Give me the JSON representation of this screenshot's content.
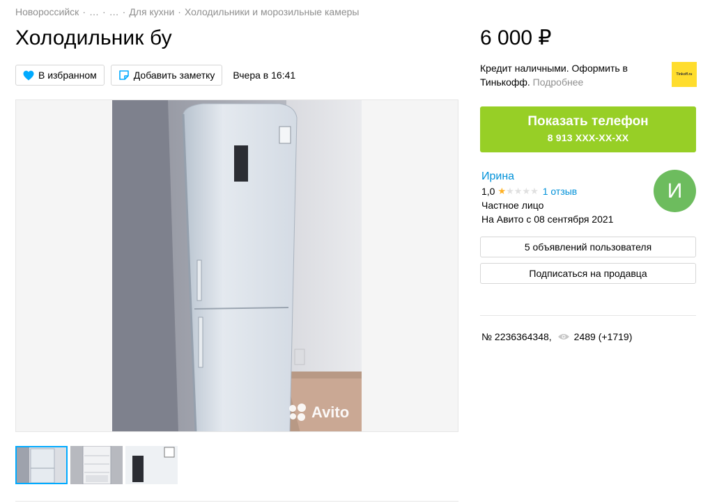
{
  "breadcrumbs": {
    "city": "Новороссийск",
    "sep": "·",
    "ellipsis1": "…",
    "ellipsis2": "…",
    "category": "Для кухни",
    "subcategory": "Холодильники и морозильные камеры"
  },
  "listing": {
    "title": "Холодильник бу",
    "favorite_label": "В избранном",
    "note_label": "Добавить заметку",
    "date": "Вчера в 16:41",
    "price": "6 000 ₽"
  },
  "gallery": {
    "watermark": "Avito",
    "active_thumb": 1,
    "thumb_count": 3
  },
  "credit": {
    "text": "Кредит наличными. Оформить в Тинькофф.",
    "more": "Подробнее",
    "logo_text": "Tinkoff.ru"
  },
  "call": {
    "label": "Показать телефон",
    "phone": "8 913 XXX-XX-XX"
  },
  "seller": {
    "name": "Ирина",
    "rating": "1,0",
    "stars_filled": 1,
    "stars_total": 5,
    "reviews": "1 отзыв",
    "type": "Частное лицо",
    "since": "На Авито с 08 сентября 2021",
    "avatar_letter": "И"
  },
  "buttons": {
    "user_ads": "5 объявлений пользователя",
    "subscribe": "Подписаться на продавца"
  },
  "meta": {
    "number": "№ 2236364348,",
    "views": "2489 (+1719)"
  },
  "colors": {
    "accent_green": "#97cf26",
    "link_blue": "#0091d9",
    "heart_blue": "#00aaff",
    "avatar_green": "#6dbc5e",
    "star": "#ffb021",
    "tinkoff_yellow": "#ffdd2d"
  },
  "icons": {
    "favorite": "heart-icon",
    "note": "note-icon",
    "views": "eye-icon",
    "watermark": "avito-logo-icon"
  }
}
